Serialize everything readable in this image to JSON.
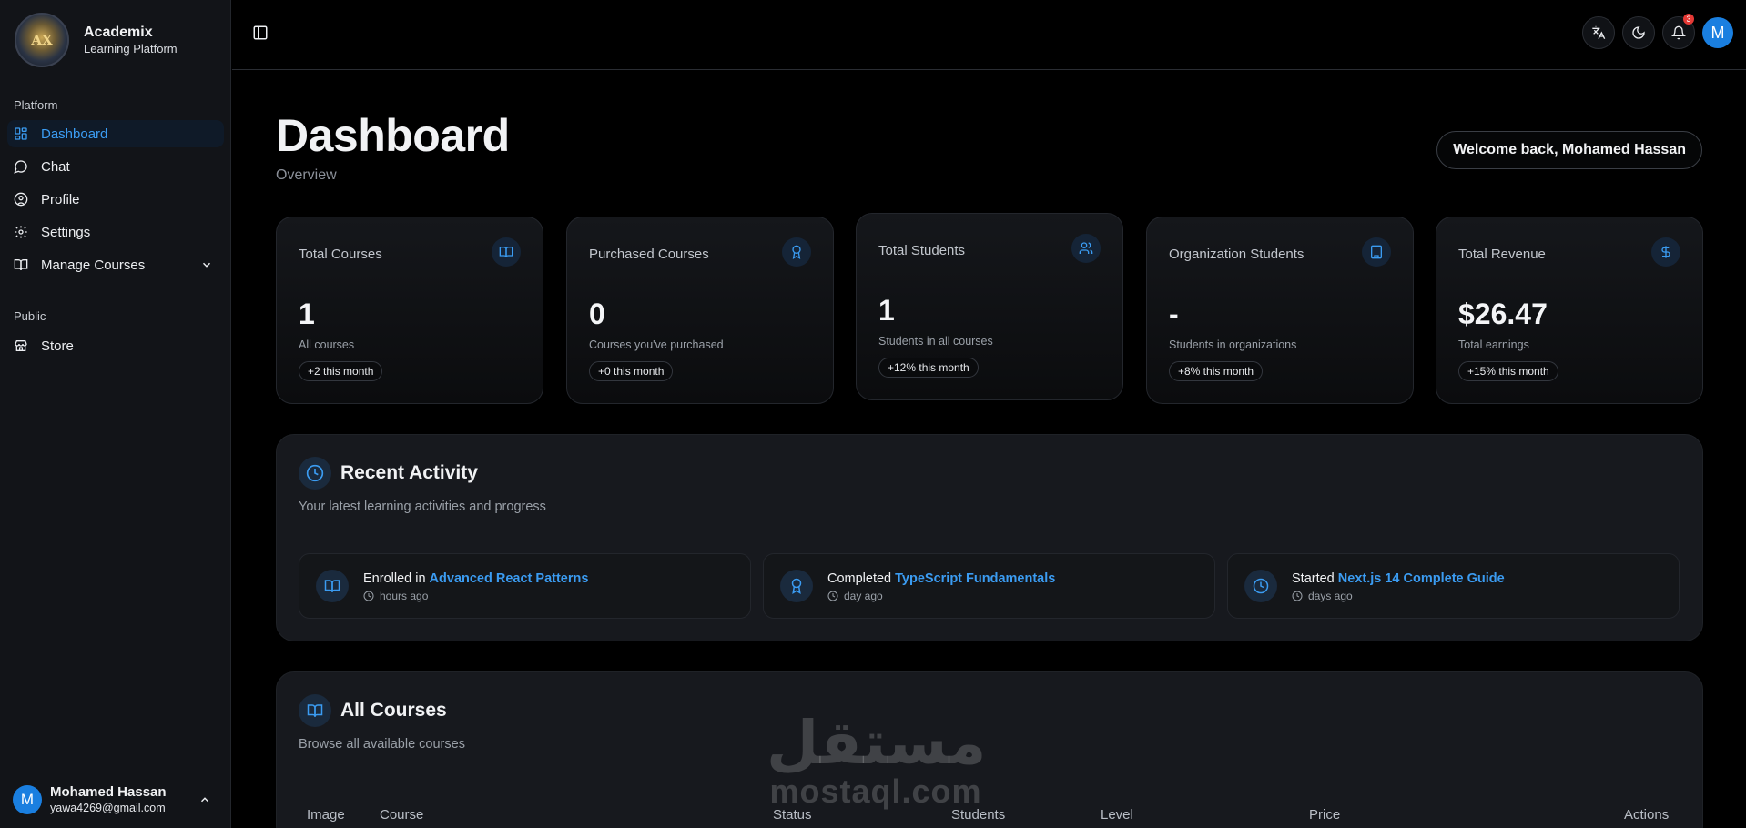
{
  "brand": {
    "name": "Academix",
    "subtitle": "Learning Platform",
    "logo_text": "AX"
  },
  "sidebar": {
    "platform_label": "Platform",
    "items": [
      {
        "label": "Dashboard",
        "icon": "dashboard-icon",
        "active": true
      },
      {
        "label": "Chat",
        "icon": "chat-icon"
      },
      {
        "label": "Profile",
        "icon": "profile-icon"
      },
      {
        "label": "Settings",
        "icon": "gear-icon"
      },
      {
        "label": "Manage Courses",
        "icon": "book-icon",
        "expandable": true
      }
    ],
    "public_label": "Public",
    "public_items": [
      {
        "label": "Store",
        "icon": "store-icon"
      }
    ]
  },
  "user": {
    "initial": "M",
    "name": "Mohamed Hassan",
    "email": "yawa4269@gmail.com"
  },
  "header": {
    "notification_count": "3",
    "avatar_initial": "M"
  },
  "page": {
    "title": "Dashboard",
    "subtitle": "Overview",
    "welcome": "Welcome back, Mohamed Hassan"
  },
  "stats": [
    {
      "label": "Total Courses",
      "value": "1",
      "desc": "All courses",
      "chip": "+2 this month",
      "icon": "book-icon"
    },
    {
      "label": "Purchased Courses",
      "value": "0",
      "desc": "Courses you've purchased",
      "chip": "+0 this month",
      "icon": "award-icon"
    },
    {
      "label": "Total Students",
      "value": "1",
      "desc": "Students in all courses",
      "chip": "+12% this month",
      "icon": "users-icon"
    },
    {
      "label": "Organization Students",
      "value": "-",
      "desc": "Students in organizations",
      "chip": "+8% this month",
      "icon": "building-icon"
    },
    {
      "label": "Total Revenue",
      "value": "$26.47",
      "desc": "Total earnings",
      "chip": "+15% this month",
      "icon": "dollar-icon"
    }
  ],
  "recent_activity": {
    "title": "Recent Activity",
    "subtitle": "Your latest learning activities and progress",
    "items": [
      {
        "verb": "Enrolled in",
        "course": "Advanced React Patterns",
        "time": "hours ago",
        "icon": "book-icon"
      },
      {
        "verb": "Completed",
        "course": "TypeScript Fundamentals",
        "time": "day ago",
        "icon": "award-icon"
      },
      {
        "verb": "Started",
        "course": "Next.js 14 Complete Guide",
        "time": "days ago",
        "icon": "clock-icon"
      }
    ]
  },
  "all_courses": {
    "title": "All Courses",
    "subtitle": "Browse all available courses",
    "columns": [
      "Image",
      "Course",
      "Status",
      "Students",
      "Level",
      "Price",
      "Actions"
    ]
  },
  "watermark": {
    "arabic": "مستقل",
    "latin": "mostaql.com"
  },
  "colors": {
    "accent": "#3b9cf2",
    "background": "#000000",
    "card": "#17191e",
    "avatar": "#1a7fe0",
    "badge": "#e53935"
  }
}
